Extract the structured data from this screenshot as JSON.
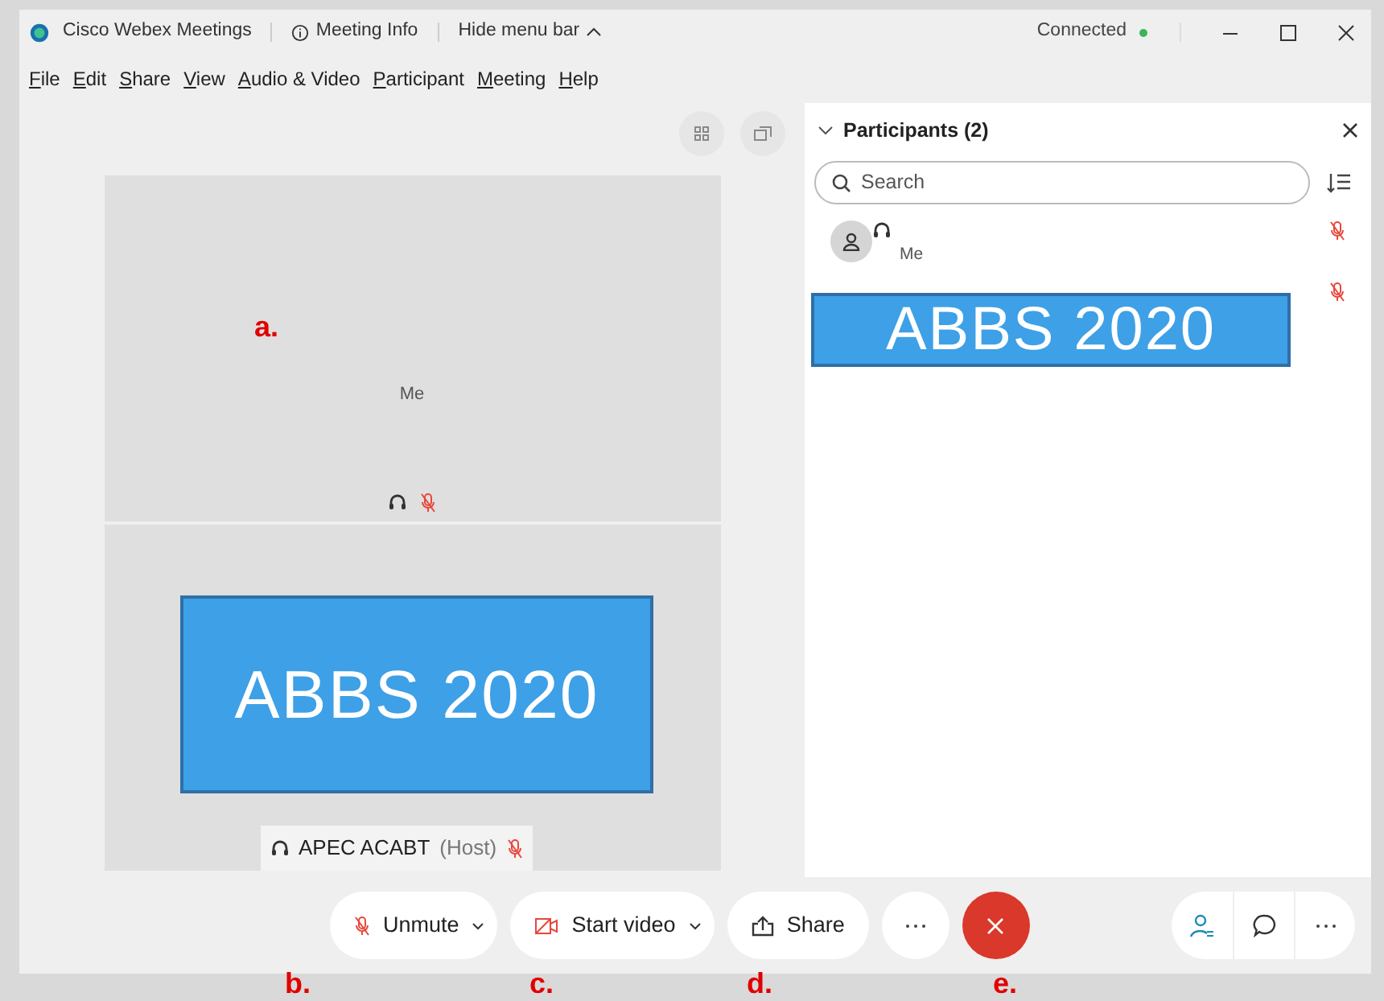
{
  "window": {
    "app_title": "Cisco Webex Meetings",
    "meeting_info": "Meeting Info",
    "hide_menu": "Hide menu bar",
    "status": "Connected"
  },
  "menu": [
    "File",
    "Edit",
    "Share",
    "View",
    "Audio & Video",
    "Participant",
    "Meeting",
    "Help"
  ],
  "participants_panel": {
    "title": "Participants (2)",
    "expanded": true,
    "search": {
      "placeholder": "Search"
    },
    "participants": [
      {
        "name": "Me",
        "muted": true
      },
      {
        "muted": true
      }
    ]
  },
  "video_tiles": [
    {
      "name": "Me",
      "muted": true
    },
    {
      "name": "APEC ACABT",
      "role": "(Host)",
      "muted": true
    }
  ],
  "toolbar": {
    "buttons": [
      {
        "kind": "mute",
        "label": "Unmute",
        "dropdown": true
      },
      {
        "kind": "video",
        "label": "Start video",
        "dropdown": true
      },
      {
        "kind": "share",
        "label": "Share",
        "dropdown": false
      },
      {
        "kind": "more"
      },
      {
        "kind": "end"
      }
    ],
    "right": [
      {
        "kind": "participants"
      },
      {
        "kind": "chat"
      },
      {
        "kind": "more"
      }
    ]
  },
  "annotations": {
    "overlays": [
      "ABBS 2020",
      "ABBS 2020"
    ],
    "labels": [
      "a.",
      "b.",
      "c.",
      "d.",
      "e."
    ]
  }
}
